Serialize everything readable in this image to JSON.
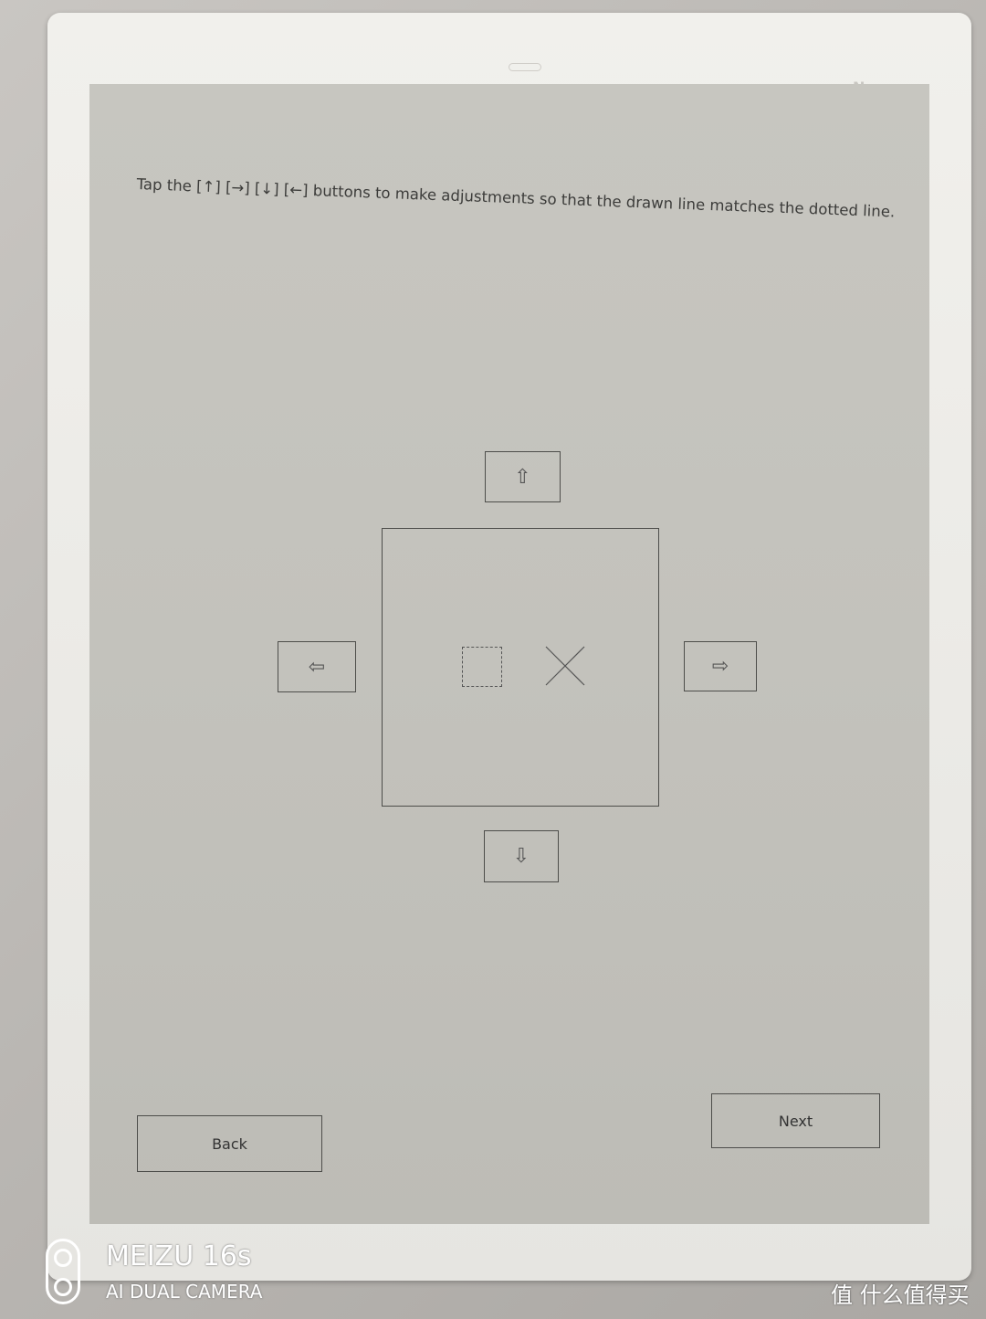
{
  "instruction": "Tap the [↑] [→] [↓] [←] buttons to make adjustments so that the drawn line matches the dotted line.",
  "controls": {
    "up": "⇧",
    "down": "⇩",
    "left": "⇦",
    "right": "⇨"
  },
  "buttons": {
    "back": "Back",
    "next": "Next"
  },
  "device": {
    "nfc_mark": "N"
  },
  "watermark": {
    "brand": "MEIZU 16s",
    "sub": "AI DUAL CAMERA",
    "site": "值 什么值得买"
  }
}
